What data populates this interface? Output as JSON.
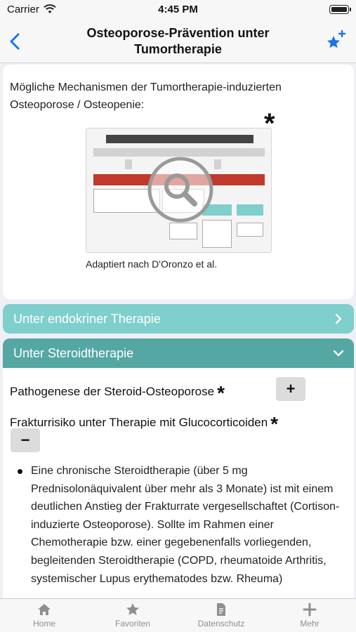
{
  "status_bar": {
    "carrier": "Carrier",
    "time": "4:45 PM"
  },
  "navbar": {
    "title": "Osteoporose-Prävention unter Tumortherapie"
  },
  "card": {
    "intro": "Mögliche Mechanismen der Tumortherapie-induzierten Osteoporose / Osteopenie:",
    "asterisk": "*",
    "caption": "Adaptiert nach D'Oronzo et al."
  },
  "accordions": [
    {
      "label": "Unter endokriner Therapie",
      "state": "collapsed"
    },
    {
      "label": "Unter Steroidtherapie",
      "state": "expanded"
    }
  ],
  "steroid_section": {
    "pathogenese": "Pathogenese der Steroid-Osteoporose",
    "pathogenese_asterisk": "*",
    "pathogenese_button": "+",
    "frakturrisiko": "Frakturrisiko unter Therapie mit Glucocorticoiden",
    "frakturrisiko_asterisk": "*",
    "frakturrisiko_button": "−",
    "bullet_text": "Eine chronische Steroidtherapie (über 5 mg Prednisolonäquivalent über mehr als 3 Monate) ist mit einem deutlichen Anstieg der Frakturrate vergesellschaftet (Cortison-induzierte Osteoporose). Sollte im Rahmen einer Chemotherapie bzw. einer gegebenenfalls vorliegenden, begleitenden Steroidtherapie (COPD, rheumatoide Arthritis, systemischer Lupus erythematodes bzw. Rheuma)"
  },
  "tabbar": [
    {
      "label": "Home",
      "icon": "home-icon"
    },
    {
      "label": "Favoriten",
      "icon": "star-icon"
    },
    {
      "label": "Datenschutz",
      "icon": "document-icon"
    },
    {
      "label": "Mehr",
      "icon": "plus-icon"
    }
  ],
  "colors": {
    "accent": "#1a73e8",
    "accordion_light": "#7fcfcc",
    "accordion_dark": "#54a7a3"
  }
}
